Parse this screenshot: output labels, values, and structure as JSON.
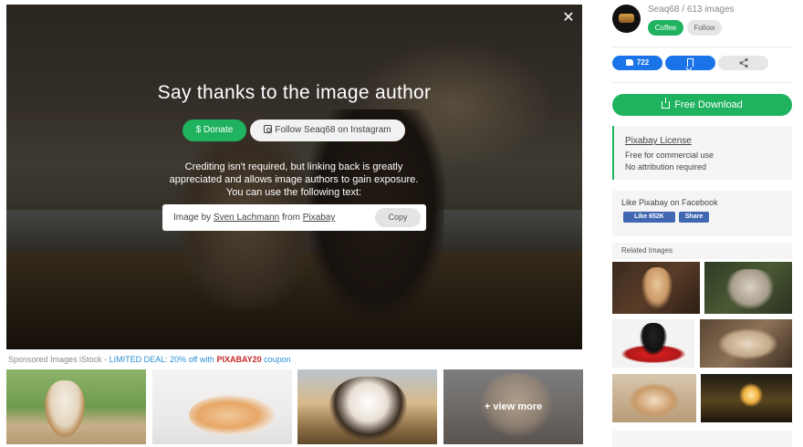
{
  "modal": {
    "close_glyph": "✕",
    "title": "Say thanks to the image author",
    "donate_label": "$ Donate",
    "follow_instagram_label": "Follow Seaq68 on Instagram",
    "credit_line1": "Crediting isn't required, but linking back is greatly",
    "credit_line2": "appreciated and allows image authors to gain exposure.",
    "credit_line3": "You can use the following text:",
    "attribution": {
      "prefix": "Image by ",
      "author": "Sven Lachmann",
      "middle": " from ",
      "site": "Pixabay"
    },
    "copy_label": "Copy"
  },
  "sponsored": {
    "prefix": "Sponsored Images iStock - ",
    "deal": "LIMITED DEAL: 20% off with ",
    "code": "PIXABAY20",
    "suffix": " coupon",
    "view_more_label": "+ view more"
  },
  "author": {
    "line": "Seaq68 / 613 images",
    "coffee_label": "Coffee",
    "follow_label": "Follow"
  },
  "actions": {
    "likes": "722",
    "download_label": "Free Download"
  },
  "license": {
    "title": "Pixabay License",
    "line1": "Free for commercial use",
    "line2": "No attribution required"
  },
  "facebook": {
    "title": "Like Pixabay on Facebook",
    "like_label": "Like 652K",
    "share_label": "Share"
  },
  "related": {
    "title": "Related Images"
  },
  "colors": {
    "accent_green": "#1fb35f",
    "accent_blue": "#1a73e8",
    "facebook_blue": "#4267b2"
  }
}
